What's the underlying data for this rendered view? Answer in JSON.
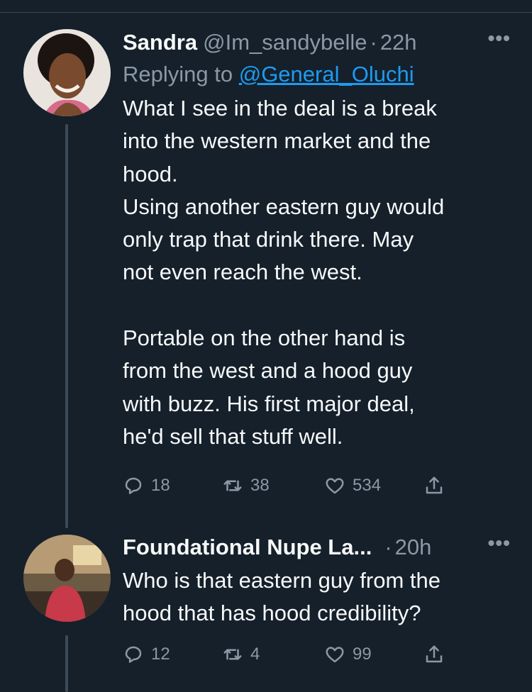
{
  "colors": {
    "background": "#15202b",
    "text": "#f7f9f9",
    "muted": "#8b98a5",
    "link": "#1d9bf0"
  },
  "tweets": [
    {
      "name": "Sandra",
      "handle": "@Im_sandybelle",
      "dot": "·",
      "time": "22h",
      "more": "•••",
      "reply_prefix": "Replying to ",
      "reply_to": "@General_Oluchi",
      "text": "What I see in the deal is a break\ninto the western market and the\nhood.\nUsing another eastern guy would\nonly trap that drink there. May\nnot even reach the west.\n\nPortable on the other hand is\nfrom the west and a hood guy\nwith buzz. His first major deal,\nhe'd sell that stuff well.",
      "replies": "18",
      "retweets": "38",
      "likes": "534"
    },
    {
      "name": "Foundational Nupe La...",
      "dot": "·",
      "time": "20h",
      "more": "•••",
      "text": "Who is that eastern guy from the\nhood that has hood credibility?",
      "replies": "12",
      "retweets": "4",
      "likes": "99"
    }
  ],
  "icons": [
    "reply-icon",
    "retweet-icon",
    "like-icon",
    "share-icon",
    "more-icon"
  ]
}
